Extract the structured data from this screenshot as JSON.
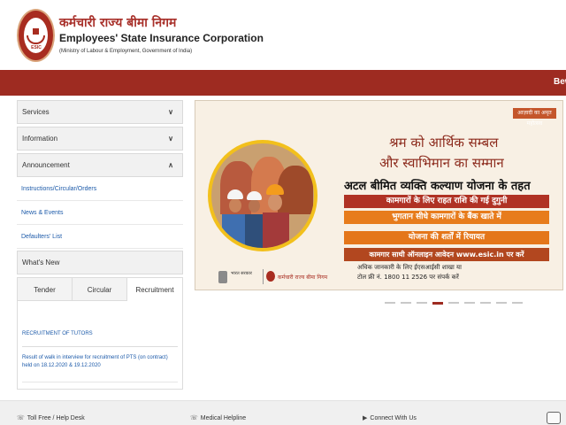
{
  "header": {
    "org_hindi": "कर्मचारी राज्य बीमा निगम",
    "org_english": "Employees' State Insurance Corporation",
    "ministry": "(Ministry of Labour & Employment, Government of India)",
    "logo_text": "ESIC"
  },
  "marquee": {
    "text": "Bew"
  },
  "sidebar": {
    "services": {
      "label": "Services",
      "chevron": "∨"
    },
    "information": {
      "label": "Information",
      "chevron": "∨"
    },
    "announcement": {
      "label": "Announcement",
      "chevron": "∧"
    },
    "links": [
      {
        "label": "Instructions/Circular/Orders"
      },
      {
        "label": "News & Events"
      },
      {
        "label": "Defaulters' List"
      }
    ],
    "whats_new": {
      "label": "What's New"
    },
    "tabs": [
      {
        "label": "Tender"
      },
      {
        "label": "Circular"
      },
      {
        "label": "Recruitment",
        "active": true
      }
    ],
    "news": {
      "title": "RECRUITMENT OF TUTORS",
      "item": "Result of walk in interview for recruitment of PTS (on contract) held on 18.12.2020 & 19.12.2020"
    }
  },
  "banner": {
    "top_button": "आज़ादी का अमृत महोत्सव",
    "line1": "श्रम को आर्थिक सम्बल",
    "line2": "और स्वाभिमान का सम्मान",
    "line3": "अटल बीमित व्यक्ति कल्याण योजना के तहत",
    "strip1": "कामगारों के लिए राहत राशि की गई दुगुनी",
    "strip2": "भुगतान सीधे कामगारों के बैंक खाते में",
    "strip3": "योजना की शर्तों में रियायत",
    "strip4": "कामगार साथी ऑनलाइन आवेदन www.esic.in पर करें",
    "foot1": "अधिक जानकारी के लिए ईएसआईसी शाखा या",
    "foot2": "टोल फ्री नं. 1800 11 2526 पर संपर्क करें",
    "gov_text": "भारत सरकार",
    "esic_text": "कर्मचारी राज्य बीमा निगम"
  },
  "slider": {
    "count": 9,
    "active_index": 3
  },
  "footer": {
    "toll_free": "Toll Free / Help Desk",
    "medical": "Medical Helpline",
    "connect": "Connect With Us"
  },
  "colors": {
    "brand_red": "#9e2b21",
    "link_blue": "#1c5aa9"
  }
}
